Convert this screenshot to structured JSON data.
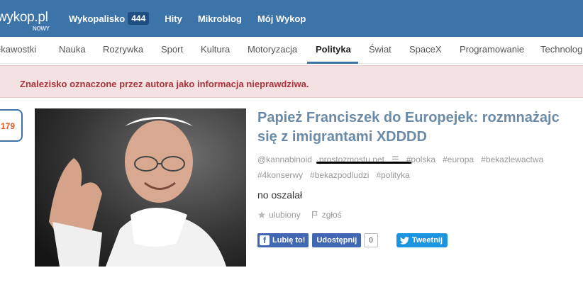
{
  "header": {
    "logo": "wykop.pl",
    "logo_sub": "NOWY",
    "nav": [
      {
        "label": "Wykopalisko",
        "badge": "444"
      },
      {
        "label": "Hity"
      },
      {
        "label": "Mikroblog"
      },
      {
        "label": "Mój Wykop"
      }
    ]
  },
  "categories": [
    "ekawostki",
    "Nauka",
    "Rozrywka",
    "Sport",
    "Kultura",
    "Motoryzacja",
    "Polityka",
    "Świat",
    "SpaceX",
    "Programowanie",
    "Technologi"
  ],
  "active_category": "Polityka",
  "alert": "Znalezisko oznaczone przez autora jako informacja nieprawdziwa.",
  "post": {
    "votes": "179",
    "title_line1": "Papież Franciszek do Europejek: rozmnażajc",
    "title_line2": "się z imigrantami XDDDD",
    "author": "@kannabinoid",
    "source": "prostozmostu.net",
    "tags_line1": [
      "#polska",
      "#europa",
      "#bekazlewactwa"
    ],
    "tags_line2": [
      "#4konserwy",
      "#bekazpodludzi",
      "#polityka"
    ],
    "description": "no oszalał",
    "favorite_label": "ulubiony",
    "report_label": "zgłoś"
  },
  "social": {
    "like_label": "Lubię to!",
    "share_label": "Udostępnij",
    "share_count": "0",
    "tweet_label": "Tweetnij"
  },
  "colors": {
    "topbar": "#3c73a8",
    "alert_bg": "#f4e2e3",
    "alert_text": "#a9333d",
    "title": "#6b8aa8",
    "votes": "#e05a24"
  }
}
